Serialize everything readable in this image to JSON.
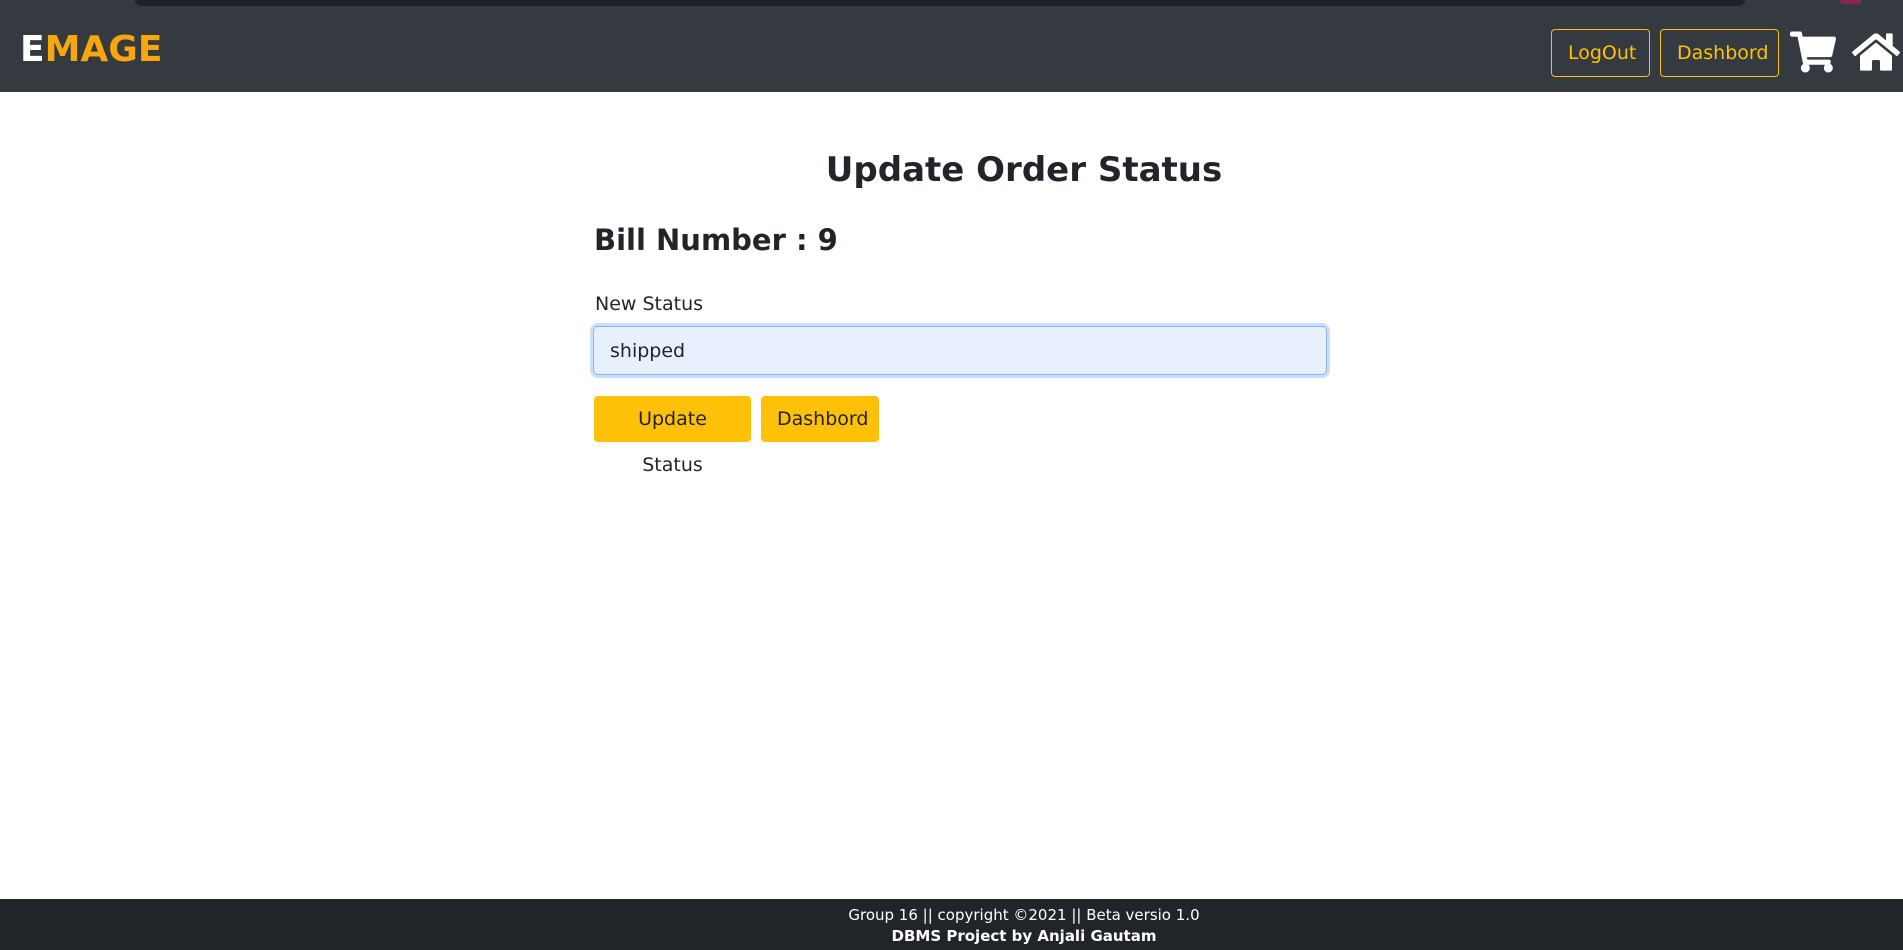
{
  "navbar": {
    "brand_first": "E",
    "brand_rest": "MAGE",
    "logout_label": "LogOut",
    "dashboard_label": "Dashbord",
    "cart_icon": "shopping-cart-icon",
    "home_icon": "home-icon",
    "accent_color": "#ffc107",
    "brand_color": "#f7a70d",
    "background_color": "#343a40"
  },
  "main": {
    "title": "Update Order Status",
    "bill_label": "Bill Number :",
    "bill_value": "9",
    "status_label": "New Status",
    "status_value": "shipped",
    "update_button": "Update Status",
    "dashboard_button": "Dashbord"
  },
  "footer": {
    "line1": "Group 16 || copyright ©2021 || Beta versio 1.0",
    "line2": "DBMS Project by Anjali Gautam",
    "background_color": "#212529"
  }
}
